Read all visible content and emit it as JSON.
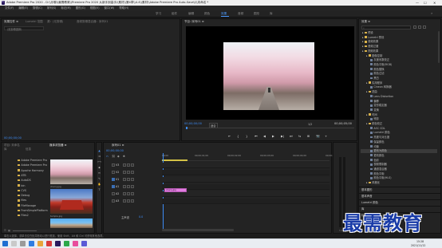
{
  "window": {
    "app_badge": "Pr",
    "title": "Adobe Premiere Pro 2020 - D:\\\\乐聊\\\\最需教育\\\\Premiere Pro 2020 从新手到高手\\\\素材\\\\第4章\\\\4.4\\\\素材\\\\Adobe Premiere Pro Auto-Save\\\\\\\\未命名 *",
    "min": "—",
    "max": "☐",
    "close": "✕"
  },
  "menu": [
    "文件(F)",
    "编辑(E)",
    "剪辑(C)",
    "序列(S)",
    "标记(M)",
    "图形(G)",
    "视图(V)",
    "窗口(W)",
    "帮助(H)"
  ],
  "workspaces": {
    "items": [
      "学习",
      "组件",
      "编辑",
      "颜色",
      "效果",
      "音频",
      "图形",
      "库"
    ],
    "active_index": 4,
    "more": "»"
  },
  "source_panel": {
    "tabs": [
      "效果控件 ≡",
      "Lumetri 范围",
      "源：(无剪辑)",
      "音频剪辑混合器：序列01"
    ],
    "message": "（无剪辑选择）",
    "timecode": "00;00;00;00"
  },
  "program": {
    "tab": "节目: 序列01 ≡",
    "timecode_left": "00;00;00;00",
    "fit": "适合",
    "quality": "1/2",
    "timecode_right": "00;00;05;00",
    "controls": [
      "⇤",
      "{",
      "}",
      "⏮",
      "◀",
      "▶",
      "▶|",
      "⏭",
      "⇆",
      "⊞",
      "📷",
      "+"
    ]
  },
  "project": {
    "tabs": [
      "项目: 未命名",
      "媒体浏览器 ≡",
      "库",
      "信息"
    ],
    "tree": [
      "Adobe Premiere Pro",
      "Adobe Premiere Pro 1",
      "Apache Harmony",
      "ATB",
      "AutoDS",
      "bin",
      "CVS",
      "Debug",
      "files",
      "FileManage",
      "FromSimplePlatform",
      "Files2"
    ],
    "clips": [
      {
        "name": "cherry.jpg",
        "duration": ""
      },
      {
        "name": "temple.jpg",
        "duration": ""
      },
      {
        "name": "sky.jpg",
        "duration": ""
      }
    ]
  },
  "timeline": {
    "tab": "序列01 ≡",
    "timecode": "00;00;00;00",
    "ruler": [
      "00;00",
      "00;00;01;00",
      "00;00;02;00",
      "00;00;03;00",
      "00;00;04;00",
      "00;00;05;00"
    ],
    "tracks": [
      {
        "id": "V3",
        "label": "V3"
      },
      {
        "id": "V2",
        "label": "V2"
      },
      {
        "id": "V1",
        "label": "V1"
      },
      {
        "id": "A1",
        "label": "A1"
      },
      {
        "id": "A2",
        "label": "A2"
      },
      {
        "id": "A3",
        "label": "A3"
      }
    ],
    "master": "主声道",
    "master_val": "0.0",
    "clip_label": "cherry.jpg"
  },
  "effects": {
    "tab": "效果 ≡",
    "search_placeholder": "",
    "sections": [
      {
        "label": "预设",
        "level": 0
      },
      {
        "label": "Lumetri 预设",
        "level": 0
      },
      {
        "label": "音频效果",
        "level": 0
      },
      {
        "label": "音频过渡",
        "level": 0
      },
      {
        "label": "视频效果",
        "level": 0
      },
      {
        "label": "图像控制",
        "level": 1
      },
      {
        "label": "灰度系数校正",
        "level": 2
      },
      {
        "label": "颜色平衡(RGB)",
        "level": 2
      },
      {
        "label": "颜色替换",
        "level": 2
      },
      {
        "label": "颜色过滤",
        "level": 2
      },
      {
        "label": "黑白",
        "level": 2
      },
      {
        "label": "实用程序",
        "level": 1
      },
      {
        "label": "Cineon 转换器",
        "level": 2
      },
      {
        "label": "扭曲",
        "level": 1
      },
      {
        "label": "Lens Distortion",
        "level": 2
      },
      {
        "label": "偏移",
        "level": 2
      },
      {
        "label": "变形稳定器",
        "level": 2
      },
      {
        "label": "变换",
        "level": 2
      },
      {
        "label": "时间",
        "level": 1
      },
      {
        "label": "残影",
        "level": 2
      },
      {
        "label": "颜色校正",
        "level": 1
      },
      {
        "label": "ASC CDL",
        "level": 2
      },
      {
        "label": "Lumetri 颜色",
        "level": 2
      },
      {
        "label": "亮度与对比度",
        "level": 2
      },
      {
        "label": "保留颜色",
        "level": 2
      },
      {
        "label": "均衡",
        "level": 2
      },
      {
        "label": "更改为颜色",
        "level": 2
      },
      {
        "label": "更改颜色",
        "level": 2
      },
      {
        "label": "色彩",
        "level": 2
      },
      {
        "label": "视频限制器",
        "level": 2
      },
      {
        "label": "通道混合器",
        "level": 2
      },
      {
        "label": "颜色平衡",
        "level": 2
      },
      {
        "label": "颜色平衡(HLS)",
        "level": 2
      },
      {
        "label": "风格化",
        "level": 1
      }
    ],
    "selected_index": 26,
    "bottom_panels": [
      "基本图形",
      "基本声音",
      "Lumetri 颜色",
      "库",
      "标记"
    ]
  },
  "status": {
    "text": "单击以选择，或单击空白处并拖动以进行框选。使用 Shift、Alt 和 Ctrl 可获得其他选项。"
  },
  "watermark": "最需教育",
  "taskbar": {
    "time": "15:28",
    "date": "2021/11/12"
  },
  "colors": {
    "accent": "#3d8cf6",
    "clip": "#e27de0"
  }
}
